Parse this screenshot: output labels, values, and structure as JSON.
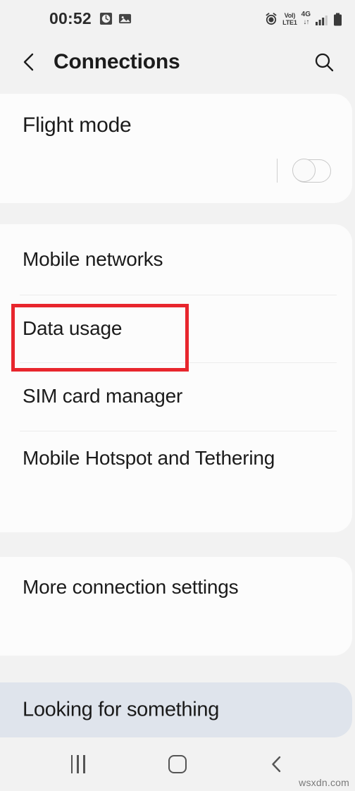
{
  "status_bar": {
    "time": "00:52",
    "left_icons": [
      "alarm-clock-icon",
      "gallery-image-icon"
    ],
    "right_icons": [
      "alarm-icon",
      "signal-bars-icon",
      "battery-icon"
    ],
    "volte_line1": "VoI)",
    "volte_line2": "LTE1",
    "network_type": "4G",
    "data_arrows": "↓↑"
  },
  "header": {
    "back_icon": "back-chevron-icon",
    "title": "Connections",
    "search_icon": "search-icon"
  },
  "flight_card": {
    "label": "Flight mode",
    "toggle_state": "off"
  },
  "list_card": {
    "items": [
      {
        "label": "Mobile networks"
      },
      {
        "label": "Data usage"
      },
      {
        "label": "SIM card manager"
      },
      {
        "label": "Mobile Hotspot and Tethering"
      }
    ]
  },
  "more_card": {
    "label": "More connection settings"
  },
  "looking_card": {
    "label": "Looking for something"
  },
  "annotation": {
    "target": "Data usage",
    "color": "#e8262d"
  },
  "nav_bar": {
    "recents_label": "recents-icon",
    "home_label": "home-icon",
    "back_label": "back-icon"
  },
  "watermark": {
    "text": "wsxdn.com"
  }
}
